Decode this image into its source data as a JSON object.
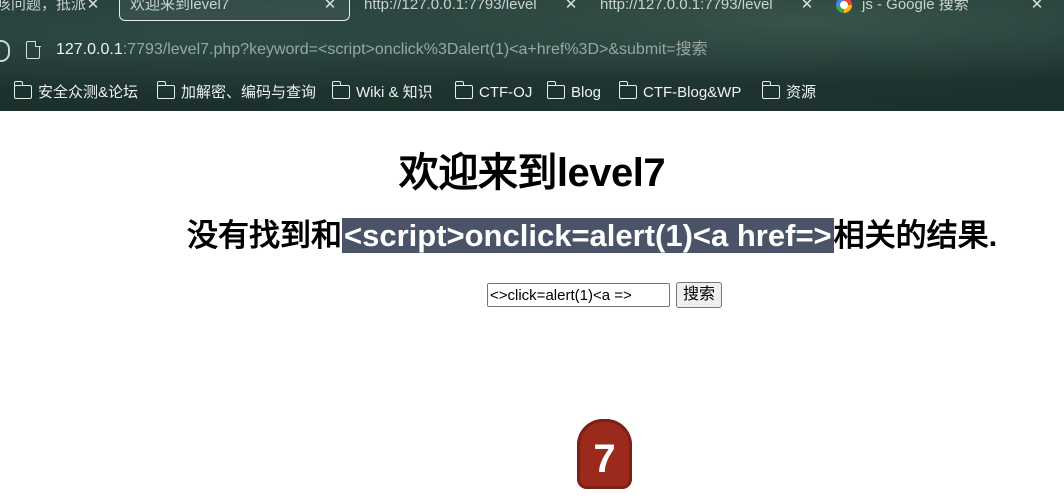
{
  "browser": {
    "tabs": [
      {
        "title": "咳问题，抵派",
        "active": false
      },
      {
        "title": "欢迎来到level7",
        "active": true
      },
      {
        "title": "http://127.0.0.1:7793/level",
        "active": false
      },
      {
        "title": "http://127.0.0.1:7793/level",
        "active": false
      },
      {
        "title": "js - Google 搜索",
        "active": false
      }
    ],
    "tab_close_glyph": "✕",
    "url_host": "127.0.0.1",
    "url_rest": ":7793/level7.php?keyword=<script>onclick%3Dalert(1)<a+href%3D>&submit=搜索",
    "bookmarks": [
      "安全众测&论坛",
      "加解密、编码与查询",
      "Wiki & 知识",
      "CTF-OJ",
      "Blog",
      "CTF-Blog&WP",
      "资源"
    ]
  },
  "page": {
    "heading": "欢迎来到level7",
    "result_prefix": "没有找到和",
    "result_keyword": "<script>onclick=alert(1)<a href=>",
    "result_suffix": "相关的结果.",
    "search_input_value": "<>click=alert(1)<a =>",
    "search_button_label": "搜索",
    "badge_text": "7"
  },
  "colors": {
    "highlight_bg": "#4a5368",
    "badge_bg": "#9b2a1d",
    "chrome_bg": "#1f3530"
  }
}
